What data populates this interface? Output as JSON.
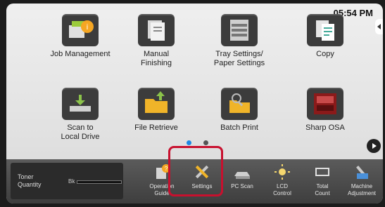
{
  "status": {
    "time": "05:54 PM"
  },
  "tiles": [
    {
      "label": "Job Management",
      "icon": "job-management-icon"
    },
    {
      "label": "Manual\nFinishing",
      "icon": "manual-finishing-icon"
    },
    {
      "label": "Tray Settings/\nPaper Settings",
      "icon": "tray-settings-icon"
    },
    {
      "label": "Copy",
      "icon": "copy-icon"
    },
    {
      "label": "Scan to\nLocal Drive",
      "icon": "scan-to-local-drive-icon"
    },
    {
      "label": "File Retrieve",
      "icon": "file-retrieve-icon"
    },
    {
      "label": "Batch Print",
      "icon": "batch-print-icon"
    },
    {
      "label": "Sharp OSA",
      "icon": "sharp-osa-icon"
    }
  ],
  "pager": {
    "active_color": "#1e88e5",
    "inactive_color": "#555555"
  },
  "toner": {
    "label": "Toner\nQuantity",
    "channel": "Bk"
  },
  "bottom_bar": [
    {
      "label": "Operation\nGuide",
      "icon": "operation-guide-icon"
    },
    {
      "label": "Settings",
      "icon": "settings-tools-icon"
    },
    {
      "label": "PC Scan",
      "icon": "pc-scan-icon"
    },
    {
      "label": "LCD\nControl",
      "icon": "lcd-control-icon"
    },
    {
      "label": "Total\nCount",
      "icon": "total-count-icon"
    },
    {
      "label": "Machine\nAdjustment",
      "icon": "machine-adjustment-icon"
    }
  ],
  "highlight_color": "#c8102e"
}
